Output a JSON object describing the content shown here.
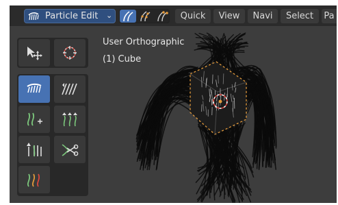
{
  "header": {
    "mode_label": "Particle Edit",
    "menus": [
      "Quick",
      "View",
      "Navi",
      "Select",
      "Pa"
    ]
  },
  "viewport": {
    "view_name": "User Orthographic",
    "object_name": "(1) Cube"
  },
  "toolbar": {
    "tools": [
      "select-box",
      "cursor",
      "comb",
      "smooth",
      "add",
      "length",
      "puff",
      "cut",
      "weight"
    ],
    "active_tool": "comb"
  },
  "colors": {
    "accent": "#4772b3",
    "header_bg": "#2b2b2b",
    "viewport_bg": "#3d3d3d",
    "icon_green": "#7cc77c",
    "icon_orange": "#e39a3c"
  }
}
